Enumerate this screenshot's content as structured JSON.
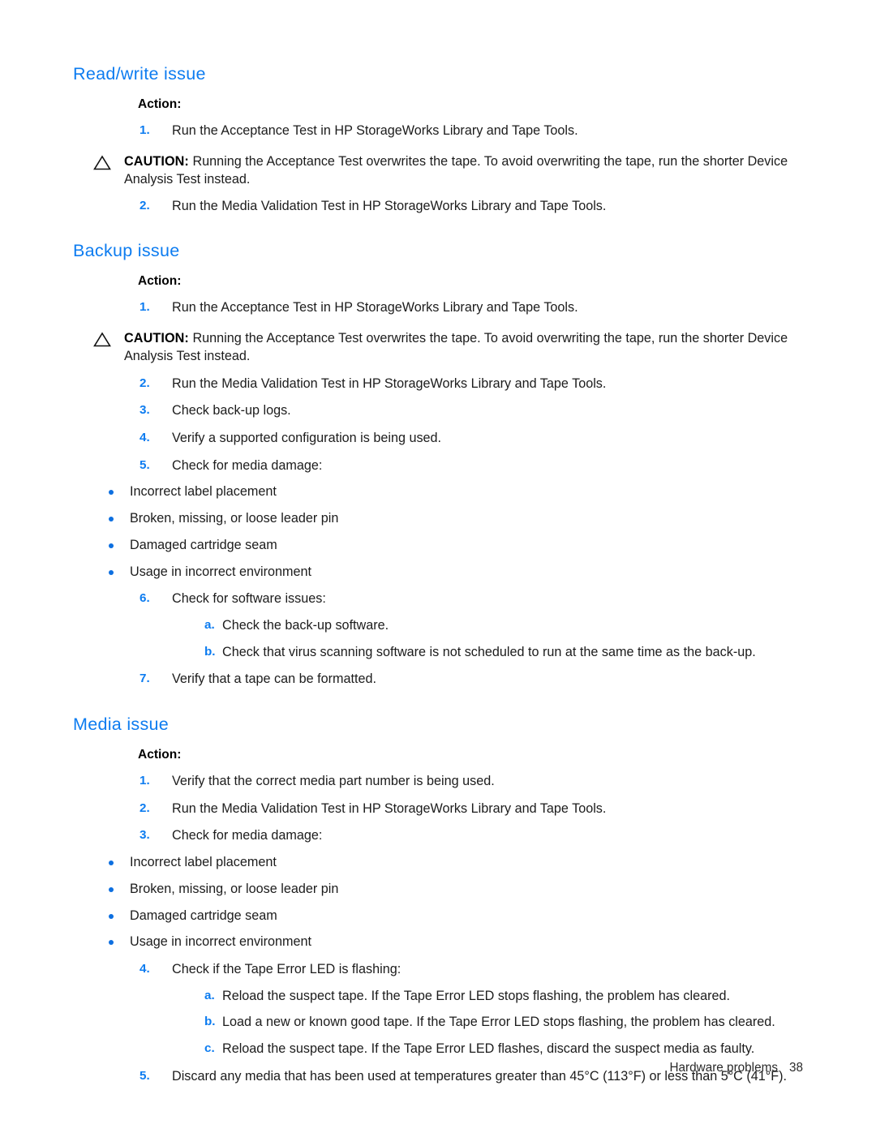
{
  "document": {
    "sections": [
      {
        "heading": "Read/write issue",
        "action_label": "Action:",
        "steps": [
          {
            "num": "1.",
            "text": "Run the Acceptance Test in HP StorageWorks Library and Tape Tools."
          }
        ],
        "caution": {
          "icon": "warning-triangle-icon",
          "label": "CAUTION:",
          "text": "Running the Acceptance Test overwrites the tape. To avoid overwriting the tape, run the shorter Device Analysis Test instead."
        },
        "steps_after": [
          {
            "num": "2.",
            "text": "Run the Media Validation Test in HP StorageWorks Library and Tape Tools."
          }
        ]
      },
      {
        "heading": "Backup issue",
        "action_label": "Action:",
        "steps": [
          {
            "num": "1.",
            "text": "Run the Acceptance Test in HP StorageWorks Library and Tape Tools."
          }
        ],
        "caution": {
          "icon": "warning-triangle-icon",
          "label": "CAUTION:",
          "text": "Running the Acceptance Test overwrites the tape. To avoid overwriting the tape, run the shorter Device Analysis Test instead."
        },
        "steps_after": [
          {
            "num": "2.",
            "text": "Run the Media Validation Test in HP StorageWorks Library and Tape Tools."
          },
          {
            "num": "3.",
            "text": "Check back-up logs."
          },
          {
            "num": "4.",
            "text": "Verify a supported configuration is being used."
          },
          {
            "num": "5.",
            "text": "Check for media damage:"
          }
        ],
        "media_damage_bullets": [
          "Incorrect label placement",
          "Broken, missing, or loose leader pin",
          "Damaged cartridge seam",
          "Usage in incorrect environment"
        ],
        "software_step": {
          "num": "6.",
          "text": "Check for software issues:"
        },
        "software_substeps": [
          {
            "alpha": "a.",
            "text": "Check the back-up software."
          },
          {
            "alpha": "b.",
            "text": "Check that virus scanning software is not scheduled to run at the same time as the back-up."
          }
        ],
        "final_step": {
          "num": "7.",
          "text": "Verify that a tape can be formatted."
        }
      },
      {
        "heading": "Media issue",
        "action_label": "Action:",
        "steps": [
          {
            "num": "1.",
            "text": "Verify that the correct media part number is being used."
          },
          {
            "num": "2.",
            "text": "Run the Media Validation Test in HP StorageWorks Library and Tape Tools."
          },
          {
            "num": "3.",
            "text": "Check for media damage:"
          }
        ],
        "media_damage_bullets": [
          "Incorrect label placement",
          "Broken, missing, or loose leader pin",
          "Damaged cartridge seam",
          "Usage in incorrect environment"
        ],
        "led_step": {
          "num": "4.",
          "text": "Check if the Tape Error LED is flashing:"
        },
        "led_substeps": [
          {
            "alpha": "a.",
            "text": "Reload the suspect tape. If the Tape Error LED stops flashing, the problem has cleared."
          },
          {
            "alpha": "b.",
            "text": "Load a new or known good tape. If the Tape Error LED stops flashing, the problem has cleared."
          },
          {
            "alpha": "c.",
            "text": "Reload the suspect tape. If the Tape Error LED flashes, discard the suspect media as faulty."
          }
        ],
        "final_step": {
          "num": "5.",
          "text": "Discard any media that has been used at temperatures greater than 45°C (113°F) or less than 5°C (41°F)."
        }
      }
    ]
  },
  "footer": {
    "chapter": "Hardware problems",
    "page_number": "38"
  },
  "colors": {
    "heading_blue": "#0d7cf0",
    "list_marker_blue": "#0d7cf0",
    "bullet_blue": "#0d6fe0",
    "body_text": "#1c1c1c",
    "page_background": "#ffffff"
  }
}
